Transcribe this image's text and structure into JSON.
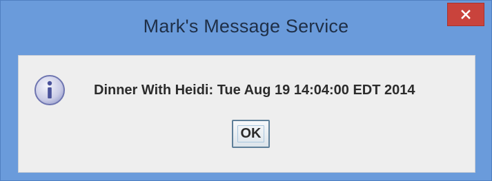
{
  "window": {
    "title": "Mark's Message Service",
    "close_label": "×"
  },
  "dialog": {
    "icon": "info-icon",
    "message": "Dinner With Heidi: Tue Aug 19 14:04:00 EDT 2014",
    "ok_label": "OK"
  },
  "colors": {
    "title_bar": "#6a9bdb",
    "close_button": "#c9433c",
    "content_bg": "#eeeeee"
  }
}
